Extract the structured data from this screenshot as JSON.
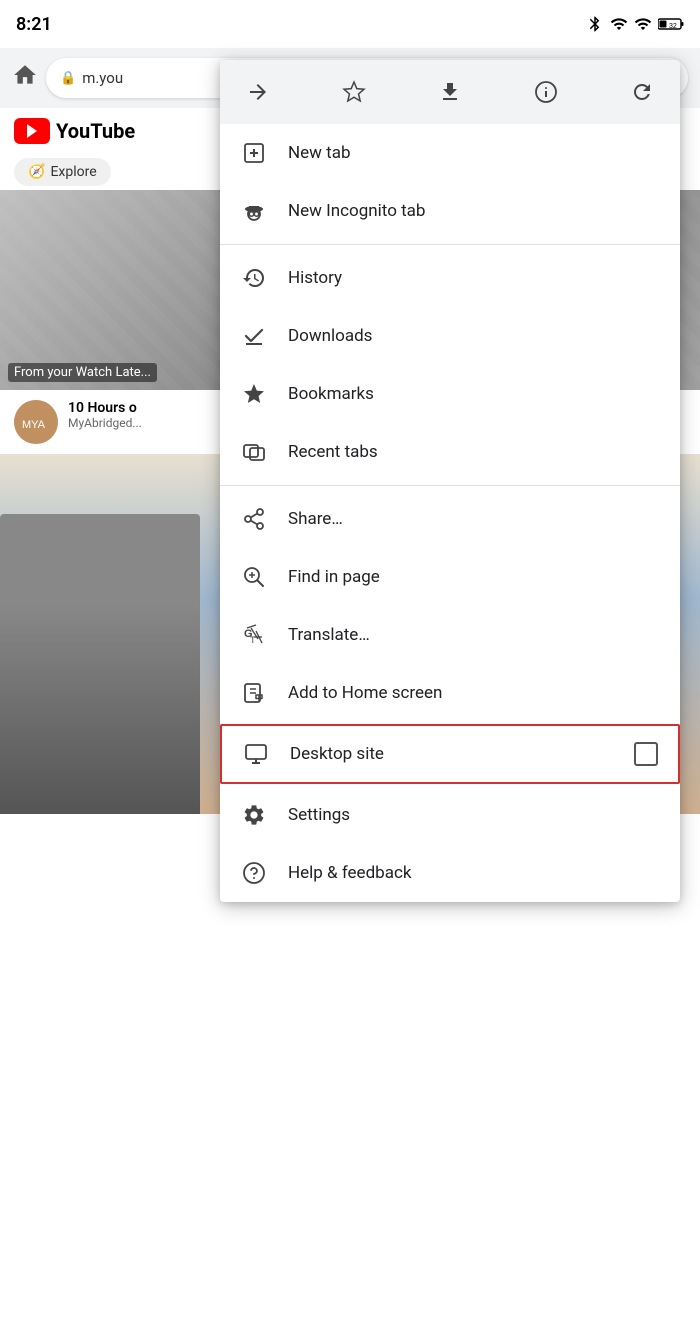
{
  "statusBar": {
    "time": "8:21",
    "battery": "32"
  },
  "browserChrome": {
    "urlText": "m.you",
    "homeLabel": "Home"
  },
  "page": {
    "youtubeLabel": "YouTube",
    "exploreLabel": "Explore",
    "watchLaterLabel": "From your Watch Late...",
    "videoTitle": "10 Hours o",
    "videoChannel": "MyAbridged..."
  },
  "dropdown": {
    "toolbar": {
      "forwardIcon": "forward-icon",
      "bookmarkIcon": "bookmark-icon",
      "downloadIcon": "download-icon",
      "infoIcon": "info-icon",
      "refreshIcon": "refresh-icon"
    },
    "items": [
      {
        "id": "new-tab",
        "label": "New tab",
        "icon": "new-tab-icon"
      },
      {
        "id": "new-incognito-tab",
        "label": "New Incognito tab",
        "icon": "incognito-icon"
      },
      {
        "id": "history",
        "label": "History",
        "icon": "history-icon"
      },
      {
        "id": "downloads",
        "label": "Downloads",
        "icon": "downloads-icon"
      },
      {
        "id": "bookmarks",
        "label": "Bookmarks",
        "icon": "bookmarks-icon"
      },
      {
        "id": "recent-tabs",
        "label": "Recent tabs",
        "icon": "recent-tabs-icon"
      },
      {
        "id": "share",
        "label": "Share…",
        "icon": "share-icon"
      },
      {
        "id": "find-in-page",
        "label": "Find in page",
        "icon": "find-icon"
      },
      {
        "id": "translate",
        "label": "Translate…",
        "icon": "translate-icon"
      },
      {
        "id": "add-to-home",
        "label": "Add to Home screen",
        "icon": "add-home-icon"
      },
      {
        "id": "desktop-site",
        "label": "Desktop site",
        "icon": "desktop-icon",
        "hasCheckbox": true,
        "highlighted": true
      },
      {
        "id": "settings",
        "label": "Settings",
        "icon": "settings-icon"
      },
      {
        "id": "help-feedback",
        "label": "Help & feedback",
        "icon": "help-icon"
      }
    ]
  }
}
